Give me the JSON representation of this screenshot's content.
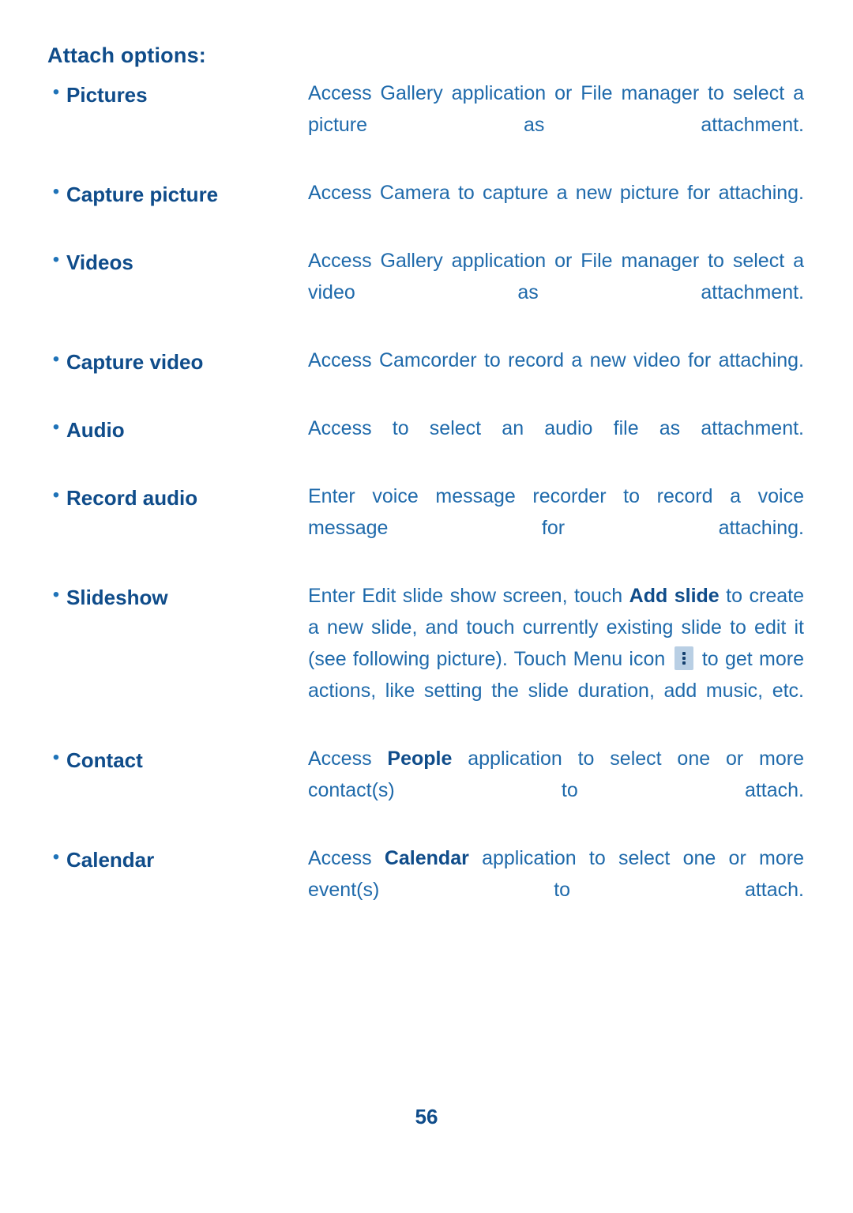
{
  "document": {
    "section_title": "Attach options:",
    "page_number": "56",
    "menu_icon_name": "menu-icon"
  },
  "rows": [
    {
      "bullet": "•",
      "term": "Pictures",
      "desc_pre": "Access Gallery application or File manager to select a picture as attachment.",
      "desc_bold": "",
      "desc_post": ""
    },
    {
      "bullet": "•",
      "term": "Capture picture",
      "desc_pre": "Access Camera to capture a new picture for attaching.",
      "desc_bold": "",
      "desc_post": ""
    },
    {
      "bullet": "•",
      "term": "Videos",
      "desc_pre": "Access Gallery application or File manager to select a video as attachment.",
      "desc_bold": "",
      "desc_post": ""
    },
    {
      "bullet": "•",
      "term": "Capture video",
      "desc_pre": "Access Camcorder to record a new video for attaching.",
      "desc_bold": "",
      "desc_post": ""
    },
    {
      "bullet": "•",
      "term": "Audio",
      "desc_pre": "Access to select an audio file as attachment.",
      "desc_bold": "",
      "desc_post": ""
    },
    {
      "bullet": "•",
      "term": "Record audio",
      "desc_pre": "Enter voice message recorder to record a voice message for attaching.",
      "desc_bold": "",
      "desc_post": ""
    },
    {
      "bullet": "•",
      "term": "Slideshow",
      "desc_pre": "Enter Edit slide show screen, touch ",
      "desc_bold": "Add slide",
      "desc_post": " to create a new slide, and touch currently existing slide to edit it (see following picture). Touch Menu icon ",
      "desc_post2": " to get more actions, like setting the slide duration, add music, etc."
    },
    {
      "bullet": "•",
      "term": "Contact",
      "desc_pre": "Access ",
      "desc_bold": "People",
      "desc_post": " application to select one or more contact(s) to attach."
    },
    {
      "bullet": "•",
      "term": "Calendar",
      "desc_pre": "Access ",
      "desc_bold": "Calendar",
      "desc_post": " application to select one or more event(s) to attach."
    }
  ]
}
